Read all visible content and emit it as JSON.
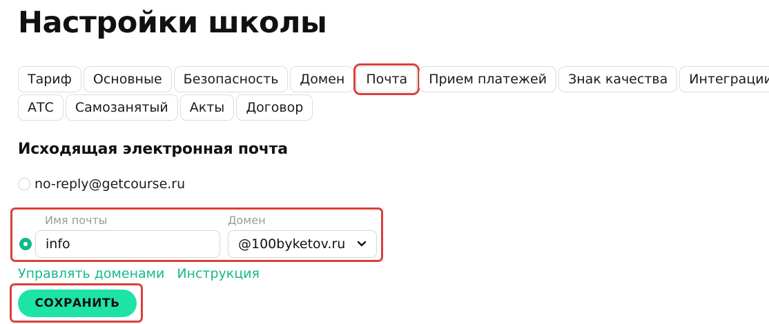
{
  "page": {
    "title": "Настройки школы"
  },
  "tabs": {
    "row1": [
      {
        "label": "Тариф"
      },
      {
        "label": "Основные"
      },
      {
        "label": "Безопасность"
      },
      {
        "label": "Домен"
      },
      {
        "label": "Почта",
        "active": true
      },
      {
        "label": "Прием платежей"
      },
      {
        "label": "Знак качества"
      },
      {
        "label": "Интеграции"
      }
    ],
    "row2": [
      {
        "label": "АТС"
      },
      {
        "label": "Самозанятый"
      },
      {
        "label": "Акты"
      },
      {
        "label": "Договор"
      }
    ]
  },
  "outgoing_mail": {
    "section_title": "Исходящая электронная почта",
    "default_option": {
      "label": "no-reply@getcourse.ru",
      "selected": false
    },
    "custom_option": {
      "selected": true,
      "name_label": "Имя почты",
      "name_value": "info",
      "domain_label": "Домен",
      "domain_value": "@100byketov.ru"
    },
    "links": {
      "manage_domains": "Управлять доменами",
      "instruction": "Инструкция"
    },
    "save_label": "СОХРАНИТЬ"
  },
  "colors": {
    "accent": "#13b98c",
    "button": "#1ee3a6",
    "highlight": "#d9403a"
  },
  "icons": {
    "domain_dropdown": "chevron-down-icon"
  }
}
